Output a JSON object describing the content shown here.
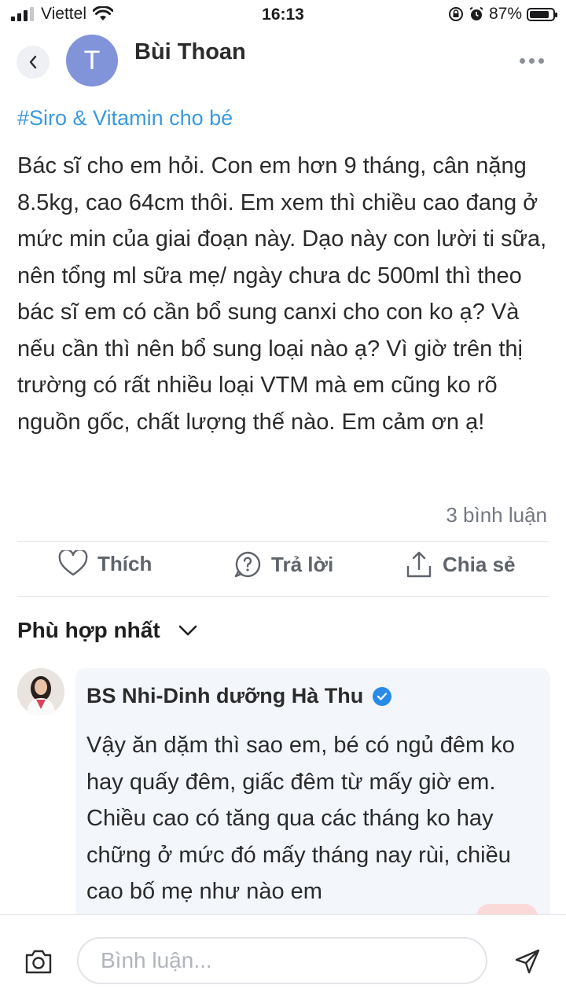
{
  "status_bar": {
    "carrier": "Viettel",
    "time": "16:13",
    "battery": "87%",
    "battery_level": 0.87
  },
  "header": {
    "avatar_letter": "T",
    "author": "Bùi Thoan"
  },
  "post": {
    "hashtag": "#Siro & Vitamin cho bé",
    "body": "Bác sĩ cho em hỏi. Con em hơn 9 tháng, cân nặng 8.5kg, cao 64cm thôi. Em xem thì chiều cao đang ở mức min của giai đoạn này. Dạo này con lười ti sữa, nên tổng ml sữa mẹ/ ngày chưa dc 500ml thì theo bác sĩ em có cần bổ sung canxi cho con ko ạ? Và nếu cần thì nên bổ sung loại nào ạ? Vì giờ trên thị trường có rất nhiều loại VTM mà em cũng ko rõ nguồn gốc, chất lượng thế nào. Em cảm ơn ạ!",
    "comment_count": "3 bình luận"
  },
  "actions": {
    "like": "Thích",
    "reply": "Trả lời",
    "share": "Chia sẻ"
  },
  "sort": {
    "label": "Phù hợp nhất"
  },
  "comment": {
    "author": "BS Nhi-Dinh dưỡng Hà Thu",
    "text": "Vậy ăn dặm thì sao em, bé có ngủ đêm ko hay quấy đêm, giấc đêm từ mấy giờ em. Chiều cao có tăng qua các tháng ko hay chững ở mức đó mấy tháng nay rùi, chiều cao bố mẹ như nào em"
  },
  "input": {
    "placeholder": "Bình luận..."
  },
  "colors": {
    "hashtag": "#3a9ae0",
    "avatar_bg": "#8193d9",
    "verified": "#2a8be6",
    "comment_bg": "#f3f6fb"
  },
  "icons": [
    "signal-icon",
    "wifi-icon",
    "lock-rotation-icon",
    "alarm-icon",
    "battery-icon",
    "back-icon",
    "more-icon",
    "heart-icon",
    "question-icon",
    "share-icon",
    "chevron-down-icon",
    "verified-icon",
    "camera-icon",
    "send-icon"
  ]
}
